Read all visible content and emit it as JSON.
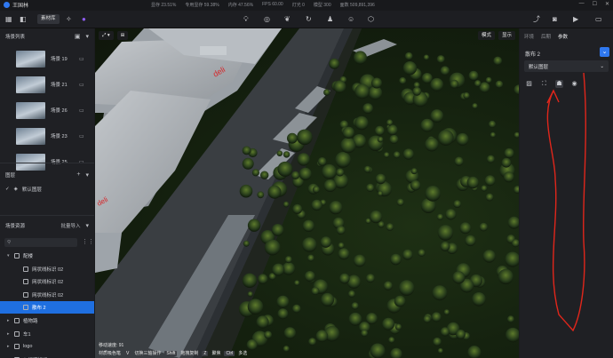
{
  "app": {
    "title": "王国林"
  },
  "stats": [
    {
      "label": "显存 23.51%"
    },
    {
      "label": "专用显存 59.38%"
    },
    {
      "label": "内存 47.56%"
    },
    {
      "label": "FPS 60.00"
    },
    {
      "label": "灯光 0"
    },
    {
      "label": "模型 300"
    },
    {
      "label": "面数 509,891,396"
    }
  ],
  "toolbar": {
    "material_lib": "素材库",
    "viewport_tabs": [
      "模式",
      "显示"
    ]
  },
  "left": {
    "scene_list_title": "场景列表",
    "scenes": [
      {
        "label": "场景 19"
      },
      {
        "label": "场景 21"
      },
      {
        "label": "场景 26"
      },
      {
        "label": "场景 23"
      },
      {
        "label": "场景 25"
      }
    ],
    "layers_title": "图层",
    "default_layer": "默认图层",
    "assets_title": "场景资源",
    "assets_action": "批量导入",
    "search_placeholder": "",
    "tree": [
      {
        "label": "配楼",
        "caret": "▾",
        "selected": false,
        "indent": 0
      },
      {
        "label": "网状线标识 02",
        "caret": "",
        "selected": false,
        "indent": 1
      },
      {
        "label": "网状线标识 02",
        "caret": "",
        "selected": false,
        "indent": 1
      },
      {
        "label": "网状线标识 02",
        "caret": "",
        "selected": false,
        "indent": 1
      },
      {
        "label": "散布 2",
        "caret": "",
        "selected": true,
        "indent": 1
      },
      {
        "label": "植物路",
        "caret": "▸",
        "selected": false,
        "indent": 0
      },
      {
        "label": "车1",
        "caret": "▸",
        "selected": false,
        "indent": 0
      },
      {
        "label": "logo",
        "caret": "▸",
        "selected": false,
        "indent": 0
      },
      {
        "label": "入行道标识 01",
        "caret": "▸",
        "selected": false,
        "indent": 0
      }
    ]
  },
  "viewport": {
    "speed": "移动速度: 91",
    "hints": [
      {
        "key": "",
        "text": "材质吸色笔"
      },
      {
        "key": "V",
        "text": "切换三轴操作"
      },
      {
        "key": "Shift",
        "text": "拖拽复制"
      },
      {
        "key": "Z",
        "text": "聚焦"
      },
      {
        "key": "Ctrl",
        "text": "多选"
      }
    ]
  },
  "right": {
    "tabs": [
      "环境",
      "后期",
      "参数"
    ],
    "object_title": "散布 2",
    "layer_select": "默认图层",
    "annotation_color": "#e0261b"
  }
}
